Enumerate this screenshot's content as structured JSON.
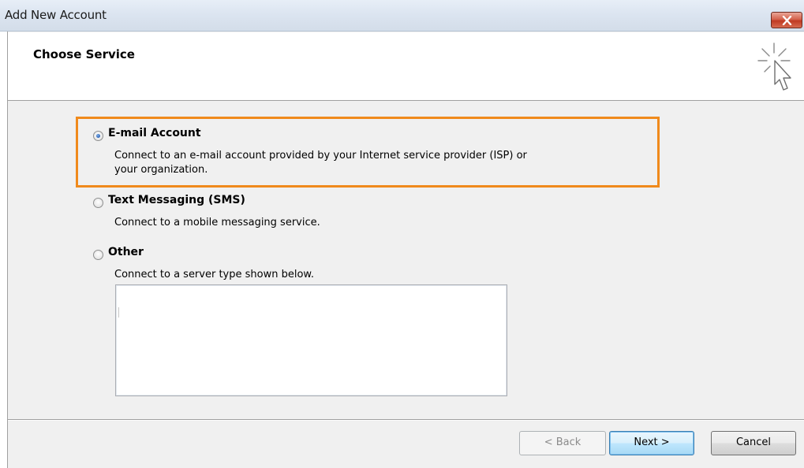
{
  "window": {
    "title": "Add New Account"
  },
  "header": {
    "title": "Choose Service"
  },
  "options": [
    {
      "label": "E-mail Account",
      "description_line1": "Connect to an e-mail account provided by your Internet service provider (ISP) or",
      "description_line2": "your organization.",
      "selected": true
    },
    {
      "label": "Text Messaging (SMS)",
      "description_line1": "Connect to a mobile messaging service.",
      "selected": false
    },
    {
      "label": "Other",
      "description_line1": "Connect to a server type shown below.",
      "selected": false
    }
  ],
  "footer": {
    "back_label": "< Back",
    "next_label": "Next >",
    "cancel_label": "Cancel"
  },
  "colors": {
    "highlight": "#f08a1c",
    "radio_selected": "#2c62b5",
    "close_button": "#c03a22"
  },
  "icons": {
    "close": "close-icon",
    "wizard": "wizard-cursor-icon"
  }
}
